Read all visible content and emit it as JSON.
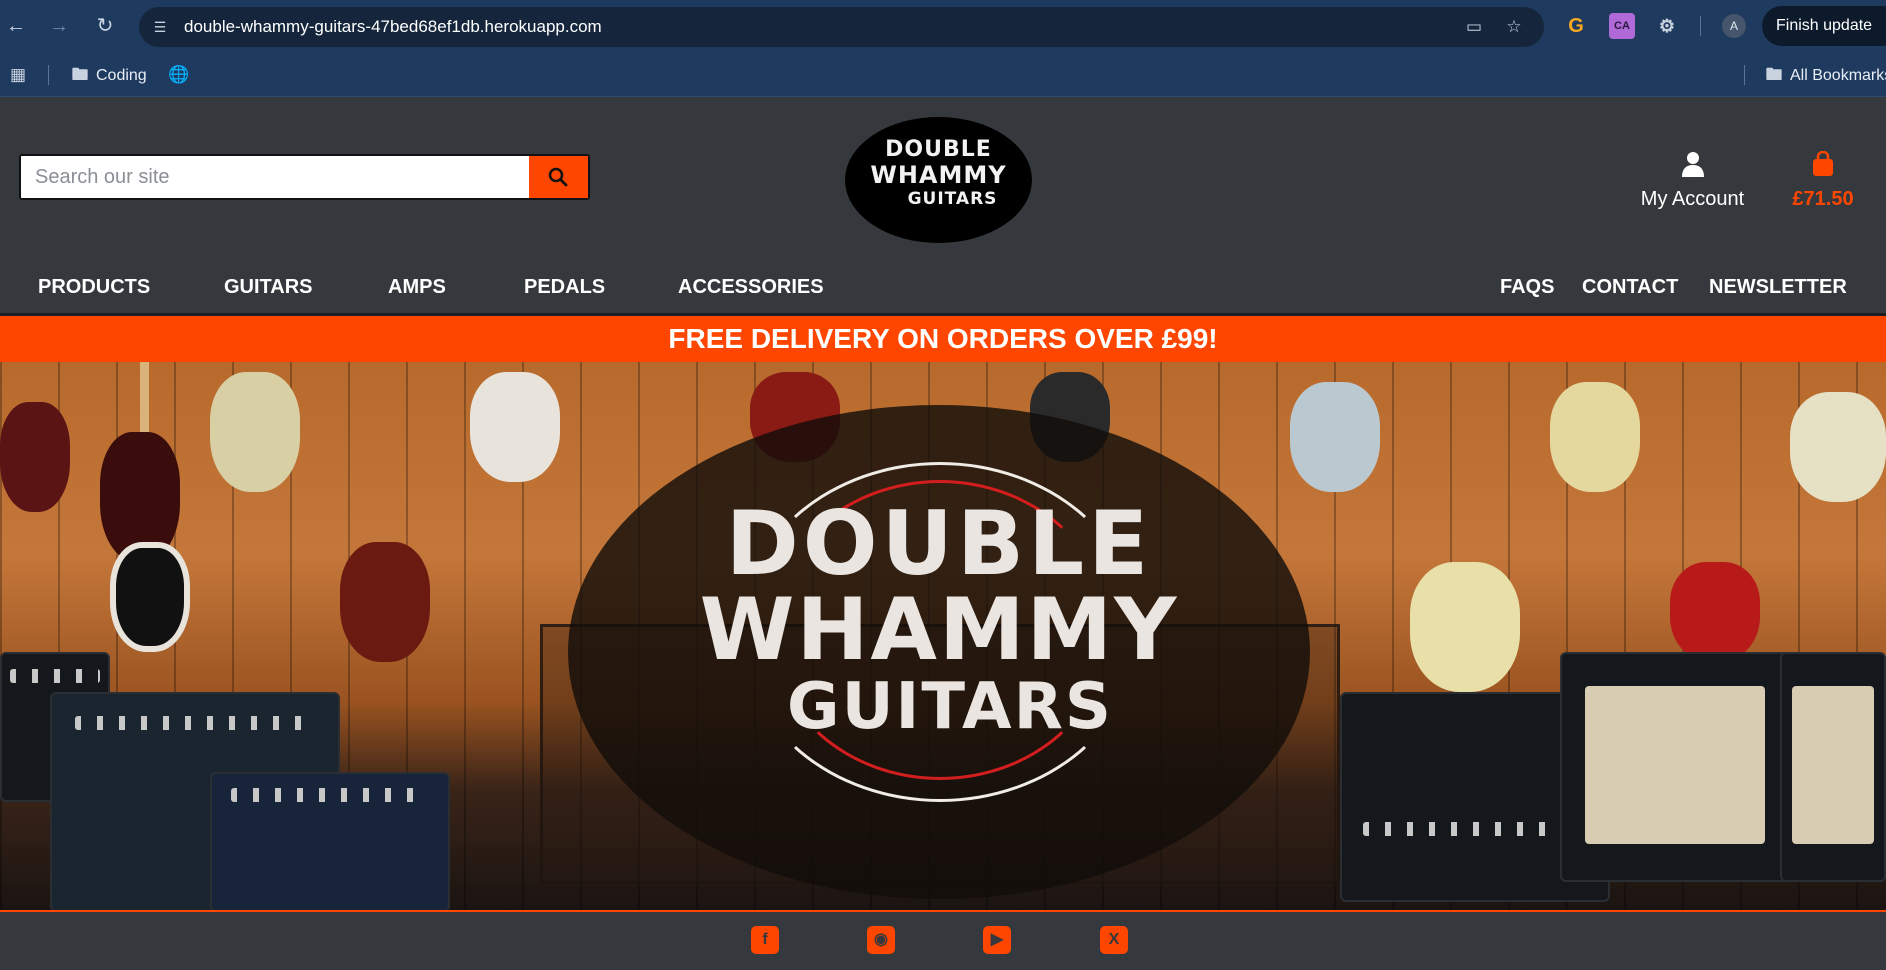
{
  "browser": {
    "url": "double-whammy-guitars-47bed68ef1db.herokuapp.com",
    "finish_update": "Finish update",
    "profile_initial": "A",
    "ext_ca": "CA",
    "bookmarks": {
      "coding": "Coding",
      "all_bookmarks": "All Bookmarks"
    }
  },
  "header": {
    "search_placeholder": "Search our site",
    "logo_line1": "DOUBLE",
    "logo_line2": "WHAMMY",
    "logo_line3": "GUITARS",
    "account_label": "My Account",
    "cart_total": "£71.50"
  },
  "nav": {
    "left": [
      "PRODUCTS",
      "GUITARS",
      "AMPS",
      "PEDALS",
      "ACCESSORIES"
    ],
    "right": [
      "FAQS",
      "CONTACT",
      "NEWSLETTER"
    ]
  },
  "banner": {
    "delivery": "FREE DELIVERY ON ORDERS OVER £99!"
  },
  "hero": {
    "line1": "DOUBLE",
    "line2": "WHAMMY",
    "line3": "GUITARS"
  },
  "footer": {
    "social": [
      "facebook-icon",
      "instagram-icon",
      "youtube-icon",
      "x-icon"
    ]
  },
  "colors": {
    "accent": "#fe4600",
    "header_bg": "#35393e",
    "chrome_bg": "#1f3a5f"
  }
}
